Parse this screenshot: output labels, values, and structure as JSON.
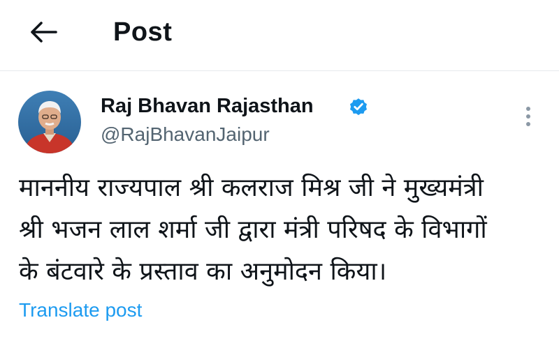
{
  "header": {
    "title": "Post",
    "back_icon": "arrow-left-icon"
  },
  "post": {
    "author": {
      "name": "Raj Bhavan Rajasthan",
      "handle": "@RajBhavanJaipur",
      "verified": true,
      "verified_icon": "verified-badge-icon",
      "avatar_icon": "avatar-photo"
    },
    "text_lines": [
      "माननीय राज्यपाल श्री कलराज मिश्र जी ने मुख्यमंत्री",
      "श्री भजन लाल शर्मा जी द्वारा मंत्री परिषद के विभागों",
      "के बंटवारे के प्रस्ताव का अनुमोदन किया।"
    ],
    "translate_label": "Translate post",
    "more_icon": "more-vertical-icon"
  },
  "colors": {
    "text_primary": "#0f1419",
    "text_secondary": "#536471",
    "accent": "#1d9bf0",
    "divider": "#e6e9ec"
  }
}
